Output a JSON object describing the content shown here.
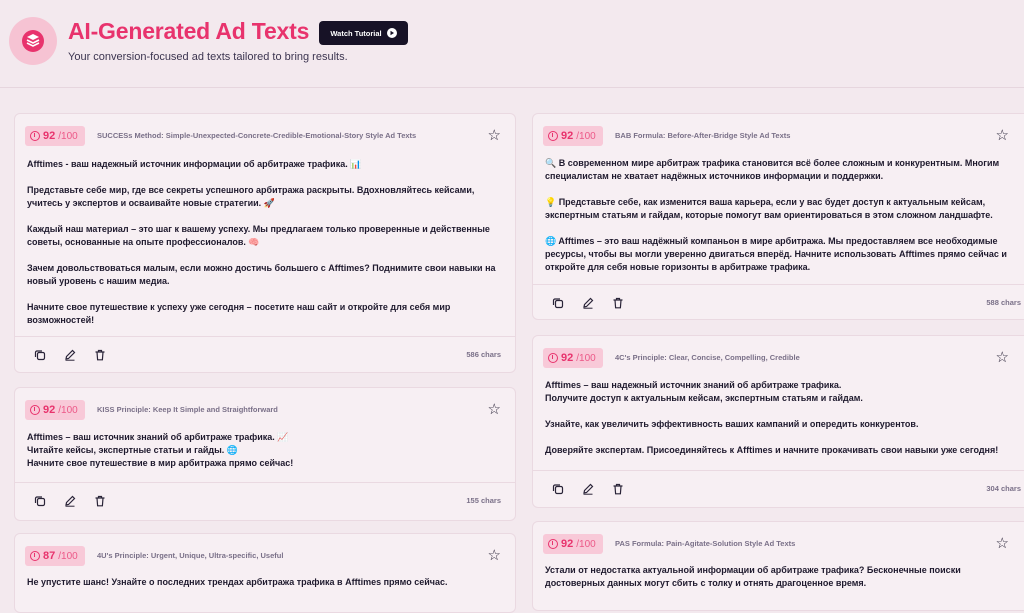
{
  "header": {
    "title": "AI-Generated Ad Texts",
    "subtitle": "Your conversion-focused ad texts tailored to bring results.",
    "tutorial_label": "Watch Tutorial"
  },
  "colors": {
    "accent": "#e8336d",
    "dark": "#171226",
    "bg": "#f3e9ee",
    "card": "#f7eff3"
  },
  "cards": [
    {
      "score": "92",
      "max": "/100",
      "method": "SUCCESs Method: Simple-Unexpected-Concrete-Credible-Emotional-Story Style Ad Texts",
      "paragraphs": [
        "Afftimes - ваш надежный источник информации об арбитраже трафика. 📊",
        "Представьте себе мир, где все секреты успешного арбитража раскрыты. Вдохновляйтесь кейсами, учитесь у экспертов и осваивайте новые стратегии. 🚀",
        "Каждый наш материал – это шаг к вашему успеху. Мы предлагаем только проверенные и действенные советы, основанные на опыте профессионалов. 🧠",
        "Зачем довольствоваться малым, если можно достичь большего с Afftimes? Поднимите свои навыки на новый уровень с нашим медиа.",
        "Начните свое путешествие к успеху уже сегодня – посетите наш сайт и откройте для себя мир возможностей!"
      ],
      "chars": "586 chars"
    },
    {
      "score": "92",
      "max": "/100",
      "method": "KISS Principle: Keep It Simple and Straightforward",
      "paragraphs": [
        "Afftimes – ваш источник знаний об арбитраже трафика. 📈",
        "Читайте кейсы, экспертные статьи и гайды. 🌐",
        "Начните свое путешествие в мир арбитража прямо сейчас!"
      ],
      "chars": "155 chars"
    },
    {
      "score": "87",
      "max": "/100",
      "method": "4U's Principle: Urgent, Unique, Ultra-specific, Useful",
      "paragraphs": [
        "Не упустите шанс! Узнайте о последних трендах арбитража трафика в Afftimes прямо сейчас."
      ]
    },
    {
      "score": "92",
      "max": "/100",
      "method": "BAB Formula: Before-After-Bridge Style Ad Texts",
      "paragraphs": [
        "🔍 В современном мире арбитраж трафика становится всё более сложным и конкурентным. Многим специалистам не хватает надёжных источников информации и поддержки.",
        "💡 Представьте себе, как изменится ваша карьера, если у вас будет доступ к актуальным кейсам, экспертным статьям и гайдам, которые помогут вам ориентироваться в этом сложном ландшафте.",
        "🌐 Afftimes – это ваш надёжный компаньон в мире арбитража. Мы предоставляем все необходимые ресурсы, чтобы вы могли уверенно двигаться вперёд. Начните использовать Afftimes прямо сейчас и откройте для себя новые горизонты в арбитраже трафика."
      ],
      "chars": "588 chars"
    },
    {
      "score": "92",
      "max": "/100",
      "method": "4C's Principle: Clear, Concise, Compelling, Credible",
      "paragraphs": [
        "Afftimes – ваш надежный источник знаний об арбитраже трафика.",
        "Получите доступ к актуальным кейсам, экспертным статьям и гайдам.",
        "Узнайте, как увеличить эффективность ваших кампаний и опередить конкурентов.",
        "Доверяйте экспертам. Присоединяйтесь к Afftimes и начните прокачивать свои навыки уже сегодня!"
      ],
      "chars": "304 chars"
    },
    {
      "score": "92",
      "max": "/100",
      "method": "PAS Formula: Pain-Agitate-Solution Style Ad Texts",
      "paragraphs": [
        "Устали от недостатка актуальной информации об арбитраже трафика? Бесконечные поиски достоверных данных могут сбить с толку и отнять драгоценное время."
      ]
    }
  ],
  "icons": {
    "logo": "layers-icon",
    "play": "play-icon",
    "star": "star-icon",
    "copy": "copy-icon",
    "edit": "edit-icon",
    "delete": "trash-icon",
    "score": "gauge-icon"
  }
}
